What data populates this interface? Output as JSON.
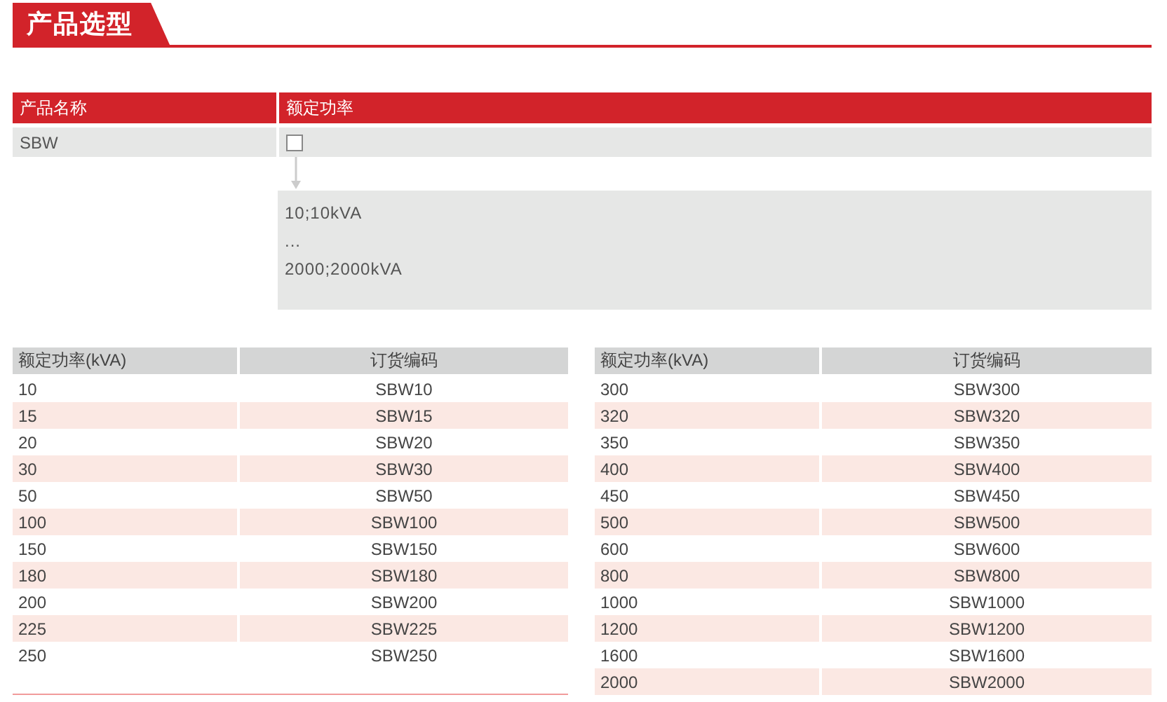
{
  "section_title": "产品选型",
  "selector": {
    "columns": [
      "产品名称",
      "额定功率"
    ],
    "product": "SBW",
    "checkbox": {
      "checked": false
    },
    "options": [
      "10;10kVA",
      "...",
      "2000;2000kVA"
    ]
  },
  "tables": [
    {
      "columns": [
        "额定功率(kVA)",
        "订货编码"
      ],
      "rows": [
        [
          "10",
          "SBW10"
        ],
        [
          "15",
          "SBW15"
        ],
        [
          "20",
          "SBW20"
        ],
        [
          "30",
          "SBW30"
        ],
        [
          "50",
          "SBW50"
        ],
        [
          "100",
          "SBW100"
        ],
        [
          "150",
          "SBW150"
        ],
        [
          "180",
          "SBW180"
        ],
        [
          "200",
          "SBW200"
        ],
        [
          "225",
          "SBW225"
        ],
        [
          "250",
          "SBW250"
        ]
      ]
    },
    {
      "columns": [
        "额定功率(kVA)",
        "订货编码"
      ],
      "rows": [
        [
          "300",
          "SBW300"
        ],
        [
          "320",
          "SBW320"
        ],
        [
          "350",
          "SBW350"
        ],
        [
          "400",
          "SBW400"
        ],
        [
          "450",
          "SBW450"
        ],
        [
          "500",
          "SBW500"
        ],
        [
          "600",
          "SBW600"
        ],
        [
          "800",
          "SBW800"
        ],
        [
          "1000",
          "SBW1000"
        ],
        [
          "1200",
          "SBW1200"
        ],
        [
          "1600",
          "SBW1600"
        ],
        [
          "2000",
          "SBW2000"
        ]
      ]
    }
  ]
}
